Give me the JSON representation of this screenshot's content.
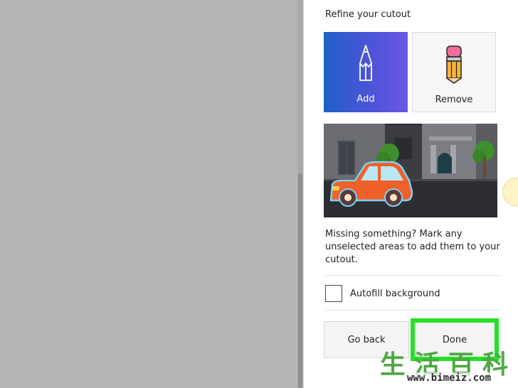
{
  "panel": {
    "title": "Refine your cutout",
    "tools": {
      "add_label": "Add",
      "remove_label": "Remove"
    },
    "help_text": "Missing something? Mark any unselected areas to add them to your cutout.",
    "autofill_label": "Autofill background",
    "go_back_label": "Go back",
    "done_label": "Done"
  },
  "watermark": {
    "chars": [
      "生",
      "活",
      "百",
      "科"
    ],
    "url": "www.bimeiz.com"
  },
  "colors": {
    "add_gradient_start": "#1f5fc7",
    "add_gradient_end": "#6a58e2",
    "done_highlight": "#24e024",
    "car_body": "#f0602a",
    "canvas_gray": "#b4b6b3"
  },
  "icons": {
    "add": "pencil-icon",
    "remove": "eraser-pencil-icon",
    "preview": "car-street-illustration"
  }
}
